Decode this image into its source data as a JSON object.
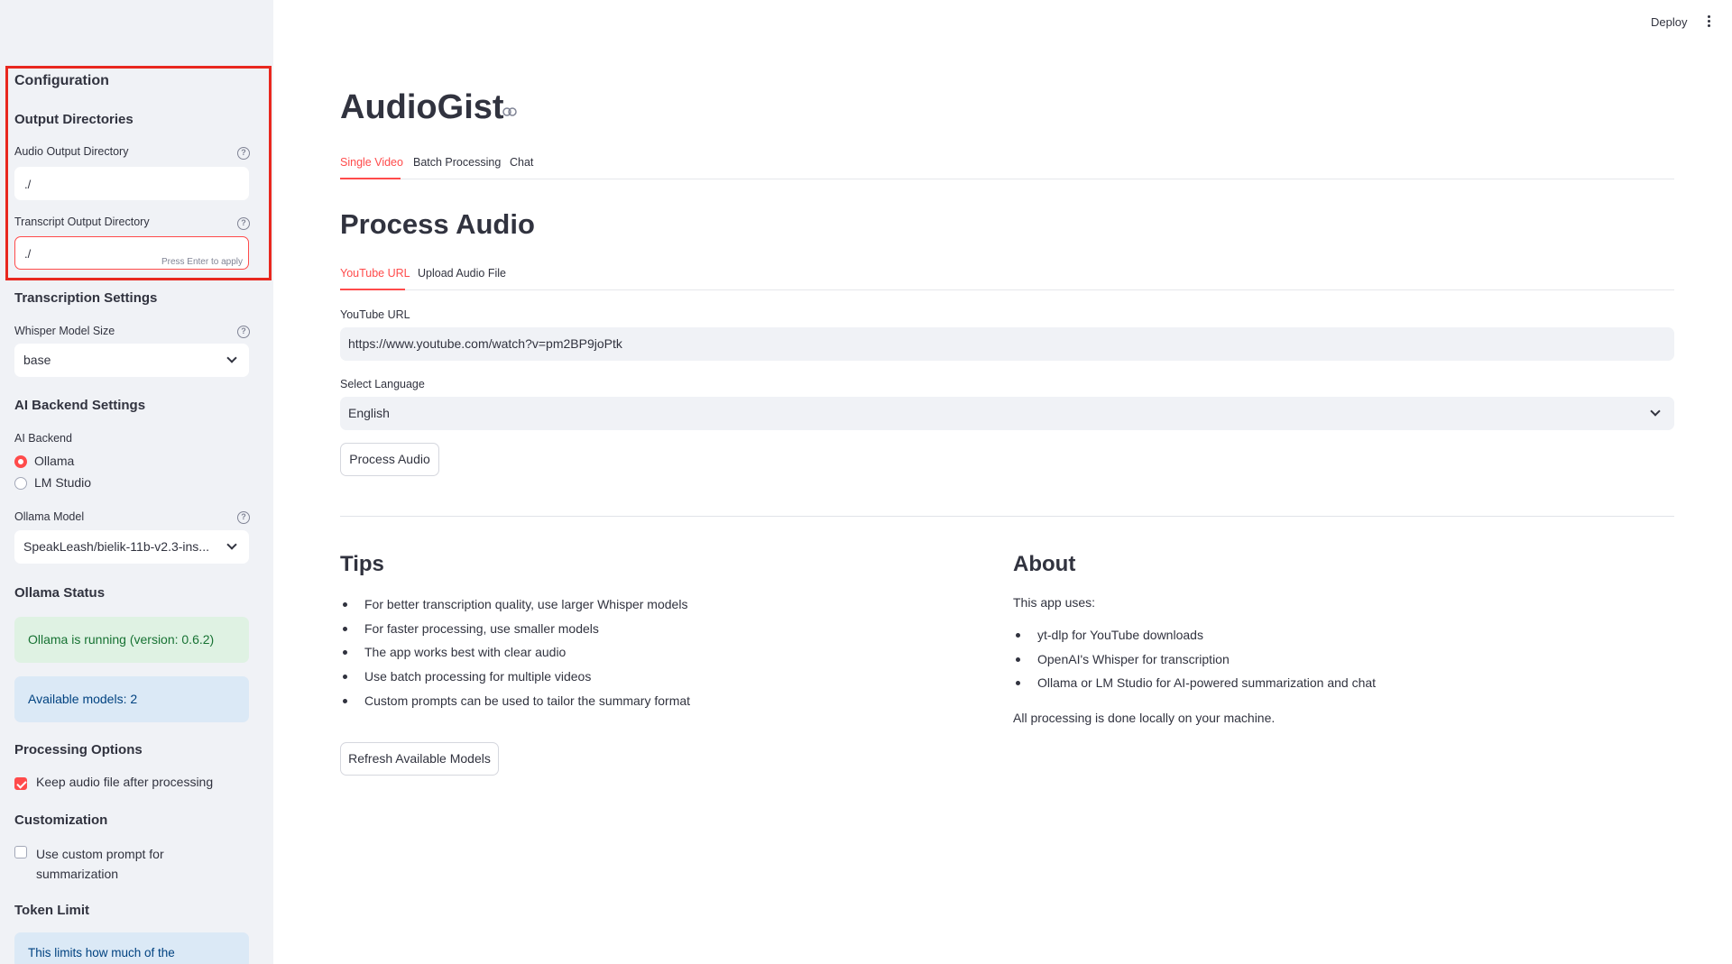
{
  "sidebar": {
    "configuration_heading": "Configuration",
    "output_directories_heading": "Output Directories",
    "audio_output_label": "Audio Output Directory",
    "audio_output_value": "./",
    "transcript_output_label": "Transcript Output Directory",
    "transcript_output_value": "./",
    "press_enter_hint": "Press Enter to apply",
    "transcription_heading": "Transcription Settings",
    "whisper_label": "Whisper Model Size",
    "whisper_value": "base",
    "ai_backend_heading": "AI Backend Settings",
    "ai_backend_label": "AI Backend",
    "backend_options": [
      {
        "label": "Ollama",
        "selected": true
      },
      {
        "label": "LM Studio",
        "selected": false
      }
    ],
    "ollama_model_label": "Ollama Model",
    "ollama_model_value": "SpeakLeash/bielik-11b-v2.3-ins...",
    "ollama_status_heading": "Ollama Status",
    "ollama_running_text": "Ollama is running (version: 0.6.2)",
    "available_models_text": "Available models: 2",
    "processing_heading": "Processing Options",
    "keep_audio_label": "Keep audio file after processing",
    "keep_audio_checked": true,
    "customization_heading": "Customization",
    "custom_prompt_label_1": "Use custom prompt for",
    "custom_prompt_label_2": "summarization",
    "custom_prompt_checked": false,
    "token_limit_heading": "Token Limit",
    "token_limit_info": "This limits how much of the"
  },
  "header": {
    "deploy_label": "Deploy"
  },
  "main": {
    "title": "AudioGist",
    "tabs": [
      "Single Video",
      "Batch Processing",
      "Chat"
    ],
    "active_tab": "Single Video",
    "process_heading": "Process Audio",
    "subtabs": [
      "YouTube URL",
      "Upload Audio File"
    ],
    "active_subtab": "YouTube URL",
    "youtube_url_label": "YouTube URL",
    "youtube_url_value": "https://www.youtube.com/watch?v=pm2BP9joPtk",
    "language_label": "Select Language",
    "language_value": "English",
    "process_button": "Process Audio",
    "tips_heading": "Tips",
    "tips": [
      "For better transcription quality, use larger Whisper models",
      "For faster processing, use smaller models",
      "The app works best with clear audio",
      "Use batch processing for multiple videos",
      "Custom prompts can be used to tailor the summary format"
    ],
    "about_heading": "About",
    "about_intro": "This app uses:",
    "about_items": [
      "yt-dlp for YouTube downloads",
      "OpenAI's Whisper for transcription",
      "Ollama or LM Studio for AI-powered summarization and chat"
    ],
    "about_footer": "All processing is done locally on your machine.",
    "refresh_button": "Refresh Available Models"
  },
  "colors": {
    "accent": "#ff4b4b",
    "sidebar_bg": "#f0f2f6",
    "success_bg": "#dff2e3",
    "info_bg": "#dbe9f6",
    "highlight_border": "#e8281f"
  }
}
